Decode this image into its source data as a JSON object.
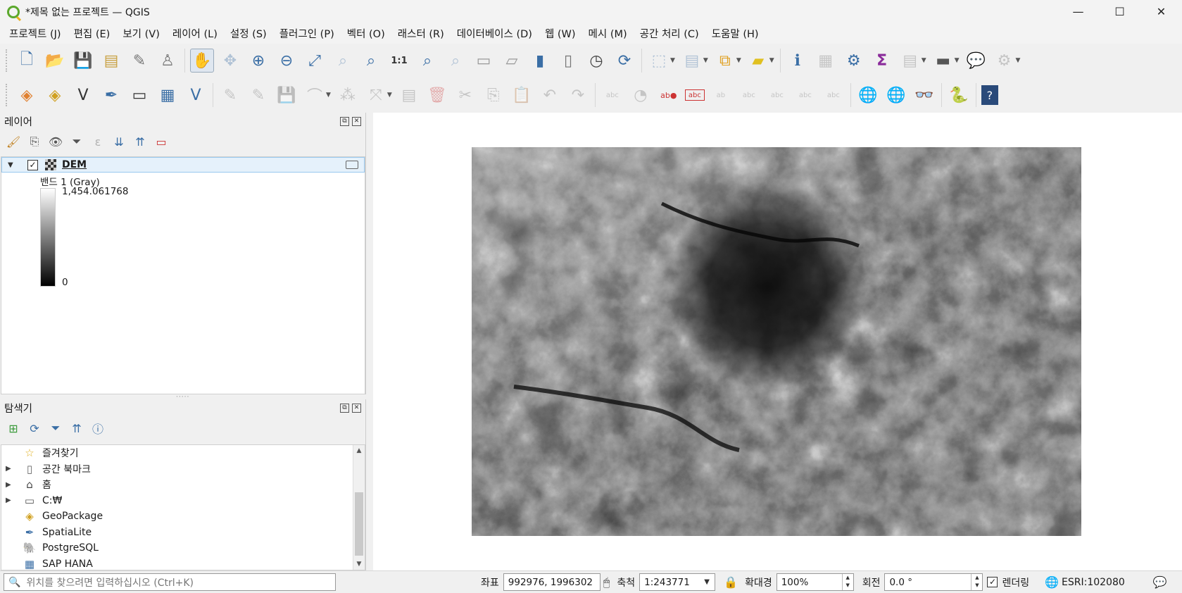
{
  "window": {
    "title": "*제목 없는 프로젝트 — QGIS",
    "minimize": "—",
    "maximize": "☐",
    "close": "✕"
  },
  "menus": [
    "프로젝트 (J)",
    "편집 (E)",
    "보기 (V)",
    "레이어 (L)",
    "설정 (S)",
    "플러그인 (P)",
    "벡터 (O)",
    "래스터 (R)",
    "데이터베이스 (D)",
    "웹 (W)",
    "메시 (M)",
    "공간 처리 (C)",
    "도움말 (H)"
  ],
  "layers_panel": {
    "title": "레이어",
    "layer_name": "DEM",
    "layer_checked": "✓",
    "band_label": "밴드 1 (Gray)",
    "max_value": "1,454.061768",
    "min_value": "0"
  },
  "browser_panel": {
    "title": "탐색기",
    "items": [
      {
        "label": "즐겨찾기",
        "icon": "star-icon",
        "glyph": "☆",
        "expandable": false
      },
      {
        "label": "공간 북마크",
        "icon": "bookmark-icon",
        "glyph": "▯",
        "expandable": true
      },
      {
        "label": "홈",
        "icon": "home-icon",
        "glyph": "⌂",
        "expandable": true
      },
      {
        "label": "C:₩",
        "icon": "folder-icon",
        "glyph": "▭",
        "expandable": true
      },
      {
        "label": "GeoPackage",
        "icon": "geopackage-icon",
        "glyph": "◈",
        "expandable": false
      },
      {
        "label": "SpatiaLite",
        "icon": "spatialite-icon",
        "glyph": "✒",
        "expandable": false
      },
      {
        "label": "PostgreSQL",
        "icon": "postgresql-icon",
        "glyph": "🐘",
        "expandable": false
      },
      {
        "label": "SAP HANA",
        "icon": "saphana-icon",
        "glyph": "▦",
        "expandable": false
      }
    ]
  },
  "statusbar": {
    "locator_placeholder": "위치를 찾으려면 입력하십시오 (Ctrl+K)",
    "coord_label": "좌표",
    "coord_value": "992976, 1996302",
    "scale_label": "축척",
    "scale_value": "1:243771",
    "magnifier_label": "확대경",
    "magnifier_value": "100%",
    "rotation_label": "회전",
    "rotation_value": "0.0 °",
    "render_label": "렌더링",
    "render_checked": "✓",
    "crs": "ESRI:102080"
  },
  "colors": {
    "accent": "#3a6ea5",
    "selection": "#e5f1fb",
    "qgis_green": "#5ba82c"
  }
}
